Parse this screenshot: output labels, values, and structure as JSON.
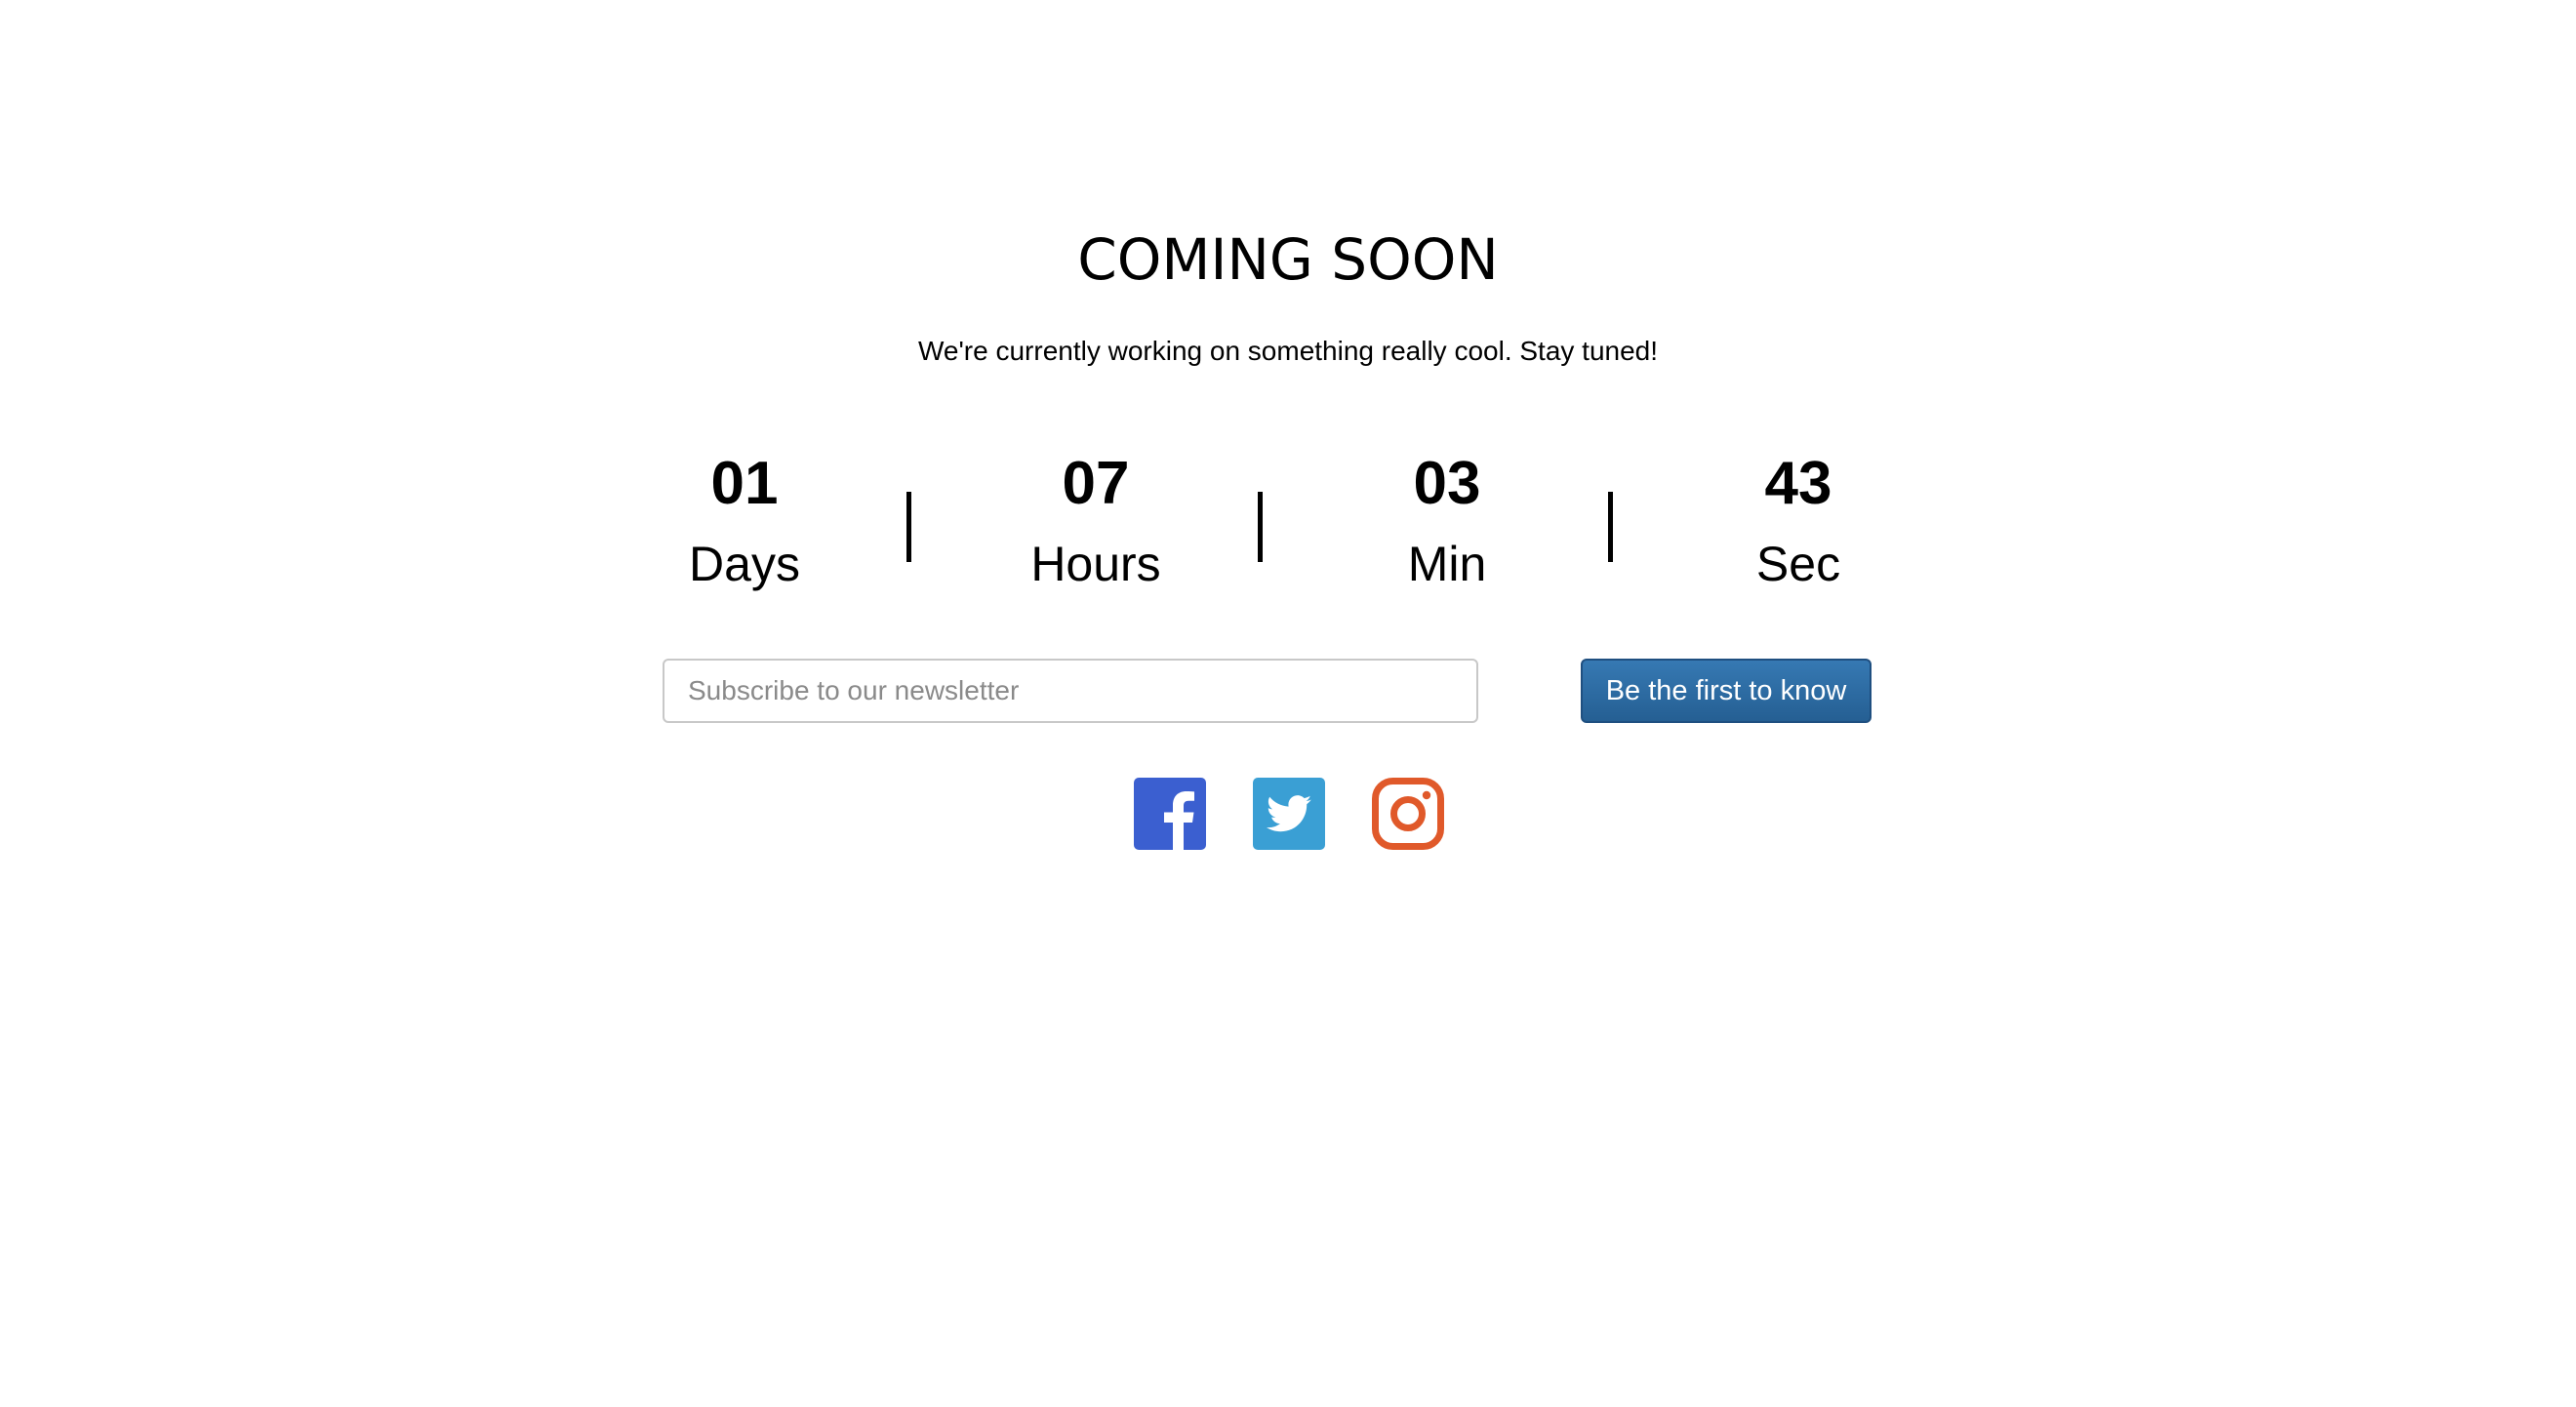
{
  "header": {
    "title": "COMING SOON",
    "subtitle": "We're currently working on something really cool. Stay tuned!"
  },
  "countdown": {
    "units": [
      {
        "value": "01",
        "label": "Days"
      },
      {
        "value": "07",
        "label": "Hours"
      },
      {
        "value": "03",
        "label": "Min"
      },
      {
        "value": "43",
        "label": "Sec"
      }
    ]
  },
  "newsletter": {
    "placeholder": "Subscribe to our newsletter",
    "value": "",
    "button_label": "Be the first to know"
  },
  "social": {
    "icons": [
      {
        "name": "facebook-icon",
        "color": "#3b5fd0"
      },
      {
        "name": "twitter-icon",
        "color": "#3a9fd4"
      },
      {
        "name": "instagram-icon",
        "color": "#e0592a"
      }
    ]
  },
  "colors": {
    "button_background": "#2f6ba3",
    "button_text": "#ffffff",
    "text": "#000000",
    "input_border": "#c8c8c8"
  }
}
